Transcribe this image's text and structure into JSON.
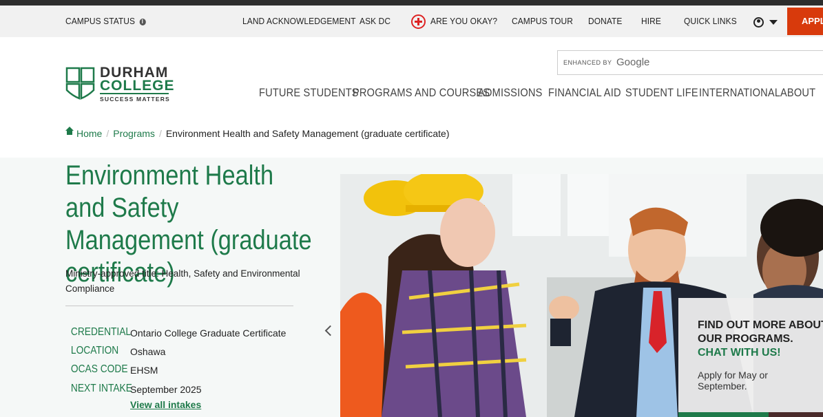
{
  "utility_nav": {
    "campus_status": "CAMPUS STATUS",
    "land_acknowledgement": "LAND ACKNOWLEDGEMENT",
    "ask_dc": "ASK DC",
    "are_you_okay": "ARE YOU OKAY?",
    "campus_tour": "CAMPUS TOUR",
    "donate": "DONATE",
    "hire": "HIRE",
    "quick_links": "QUICK LINKS",
    "apply": "APPLY"
  },
  "logo": {
    "line1": "DURHAM",
    "line2": "COLLEGE",
    "tagline": "SUCCESS MATTERS"
  },
  "search": {
    "enhanced_by": "ENHANCED BY",
    "brand": "Google"
  },
  "main_nav": [
    {
      "label": "FUTURE STUDENTS"
    },
    {
      "label": "PROGRAMS AND COURSES"
    },
    {
      "label": "ADMISSIONS"
    },
    {
      "label": "FINANCIAL AID"
    },
    {
      "label": "STUDENT LIFE"
    },
    {
      "label": "INTERNATIONAL"
    },
    {
      "label": "ABOUT"
    }
  ],
  "breadcrumb": {
    "home": "Home",
    "programs": "Programs",
    "current": "Environment Health and Safety Management (graduate certificate)"
  },
  "program": {
    "title": "Environment Health and Safety Management (graduate certificate)",
    "ministry_title": "Ministry-approved title: Health, Safety and Environmental Compliance",
    "facts": [
      {
        "key": "CREDENTIAL",
        "value": "Ontario College Graduate Certificate"
      },
      {
        "key": "LOCATION",
        "value": "Oshawa"
      },
      {
        "key": "OCAS CODE",
        "value": "EHSM"
      },
      {
        "key": "NEXT INTAKE",
        "value": "September 2025"
      }
    ],
    "view_intakes": "View all intakes"
  },
  "cta": {
    "heading": "FIND OUT MORE ABOUT OUR PROGRAMS.",
    "chat": "CHAT WITH US!",
    "text": "Apply for May or September."
  },
  "colors": {
    "brand_green": "#1e7a4a",
    "apply_orange": "#d83a0c",
    "utility_bg": "#f1f1f1"
  },
  "icons": {
    "status_info": "info-icon",
    "are_you_okay": "medical-cross-icon",
    "account": "user-icon",
    "home": "home-icon",
    "carousel": "chevron-left-icon"
  }
}
